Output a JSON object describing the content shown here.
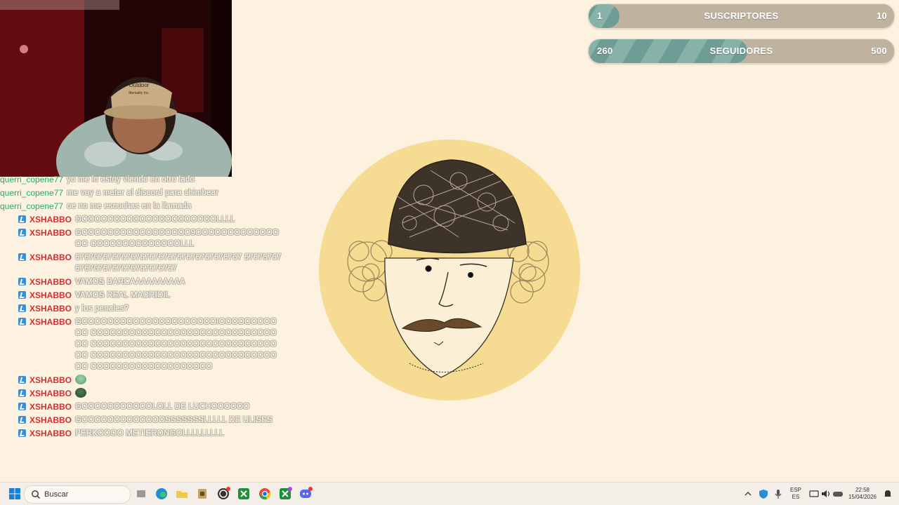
{
  "goals": {
    "subs": {
      "current": "1",
      "label": "SUSCRIPTORES",
      "target": "10",
      "progress": 0.1
    },
    "followers": {
      "current": "260",
      "label": "SEGUIDORES",
      "target": "500",
      "progress": 0.52
    }
  },
  "webcam": {
    "cap_text": "Outdoor",
    "cap_text2": "Mentality Inc."
  },
  "chat": {
    "messages": [
      {
        "user": "querri_copene77",
        "text": "yo me lo estoy viendo en otro lado",
        "type": "plain"
      },
      {
        "user": "querri_copene77",
        "text": "me voy a meter al discord para chimbear",
        "type": "plain"
      },
      {
        "user": "querri_copene77",
        "text": "oe no me escuchas en la llamada",
        "type": "plain"
      },
      {
        "user": "XSHABBO",
        "text": "GOOOOOOOOOOOOOOOOOOOOOLLLL",
        "type": "badge"
      },
      {
        "user": "XSHABBO",
        "text": "GOOOOOOOOOOOOOOOOO9OOOOOOOOOOOOOOO OOOOOOOOOOOOOOLLL",
        "type": "badge"
      },
      {
        "user": "XSHABBO",
        "text": "676767676767676767676767676767676767 676767676767676767676767676767",
        "type": "badge"
      },
      {
        "user": "XSHABBO",
        "text": "VAMOS BARCAAAAAAAAAA",
        "type": "badge"
      },
      {
        "user": "XSHABBO",
        "text": "VAMOS REAL MADRIDIL",
        "type": "badge"
      },
      {
        "user": "XSHABBO",
        "text": "y los penales?",
        "type": "badge"
      },
      {
        "user": "XSHABBO",
        "text": "GOOOOOOOOOOOOOOOOOOOOOIOOOOOOOOOOO OOOOOOOOOOOOOOOOOOOOOOOOOOOOOOO OOOOOOOOOOOOOOOOOOOOOOOOOOOOOOO OOOOOOOOOOOOOOOOOOOOOOOOOOOOOOO OOOOOOOOOOOOOOOOOOO",
        "type": "badge"
      },
      {
        "user": "XSHABBO",
        "text": "",
        "type": "emote1"
      },
      {
        "user": "XSHABBO",
        "text": "",
        "type": "emote2"
      },
      {
        "user": "XSHABBO",
        "text": "GOOOOOOOOOOOLOLL DE LUCHOOOOOO",
        "type": "badge"
      },
      {
        "user": "XSHABBO",
        "text": "GOOOOOOOOOOOOOSSSSSSSLLLLL DE ULISES",
        "type": "badge"
      },
      {
        "user": "XSHABBO",
        "text": "PERKOOOO METIERONGOLLLLLLLLL",
        "type": "badge"
      }
    ]
  },
  "taskbar": {
    "search_placeholder": "Buscar",
    "lang_top": "ESP",
    "lang_bottom": "ES",
    "time": "22:58",
    "date": "15/04/2026"
  },
  "colors": {
    "background": "#fcf2df",
    "goal_fill": "#6f9c95",
    "goal_track": "#bfb3a0",
    "avatar_circle": "#f5dc92",
    "chat_user": "#d62b2b"
  }
}
